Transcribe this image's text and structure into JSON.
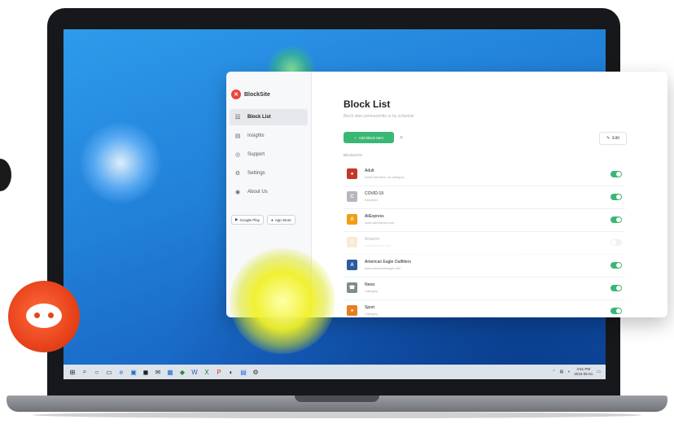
{
  "app": {
    "brand": "BlockSite",
    "nav": [
      {
        "icon": "☷",
        "label": "Block List",
        "active": true
      },
      {
        "icon": "▤",
        "label": "Insights",
        "active": false
      },
      {
        "icon": "◎",
        "label": "Support",
        "active": false
      },
      {
        "icon": "⚙",
        "label": "Settings",
        "active": false
      },
      {
        "icon": "◉",
        "label": "About Us",
        "active": false
      }
    ],
    "store_badges": [
      "Google Play",
      "App Store"
    ],
    "page_title": "Block List",
    "page_subtitle": "Block sites permanently or by schedule",
    "add_button": "Add Block Item",
    "edit_button": "Edit",
    "section_label": "Blocked list",
    "items": [
      {
        "name": "Adult",
        "sub": "Adult websites, by category",
        "icon_letter": "●",
        "color": "#c0392b",
        "enabled": true
      },
      {
        "name": "COVID-19",
        "sub": "Keyword",
        "icon_letter": "C",
        "color": "#b4b8bd",
        "enabled": true
      },
      {
        "name": "AliExpress",
        "sub": "www.aliexpress.com",
        "icon_letter": "A",
        "color": "#f39c12",
        "enabled": true
      },
      {
        "name": "Amazon",
        "sub": "www.amazon.com",
        "icon_letter": "A",
        "color": "#f5c08a",
        "enabled": false
      },
      {
        "name": "American Eagle Outfitters",
        "sub": "www.americaneagle.com",
        "icon_letter": "A",
        "color": "#2c5aa0",
        "enabled": true
      },
      {
        "name": "News",
        "sub": "Category",
        "icon_letter": "☎",
        "color": "#7f8c8d",
        "enabled": true
      },
      {
        "name": "Sport",
        "sub": "Category",
        "icon_letter": "●",
        "color": "#e67e22",
        "enabled": true
      }
    ]
  },
  "taskbar": {
    "icons": [
      "⌕",
      "○",
      "▭",
      "e",
      "▣",
      "◼",
      "✉",
      "▦",
      "◆",
      "W",
      "X",
      "P",
      "◐",
      "▤",
      "⚙"
    ],
    "time": "4:51 PM",
    "date": "2019-05-01"
  },
  "colors": {
    "accent": "#3ab774",
    "reddit": "#e8431b",
    "desktop": "#2180d8"
  }
}
